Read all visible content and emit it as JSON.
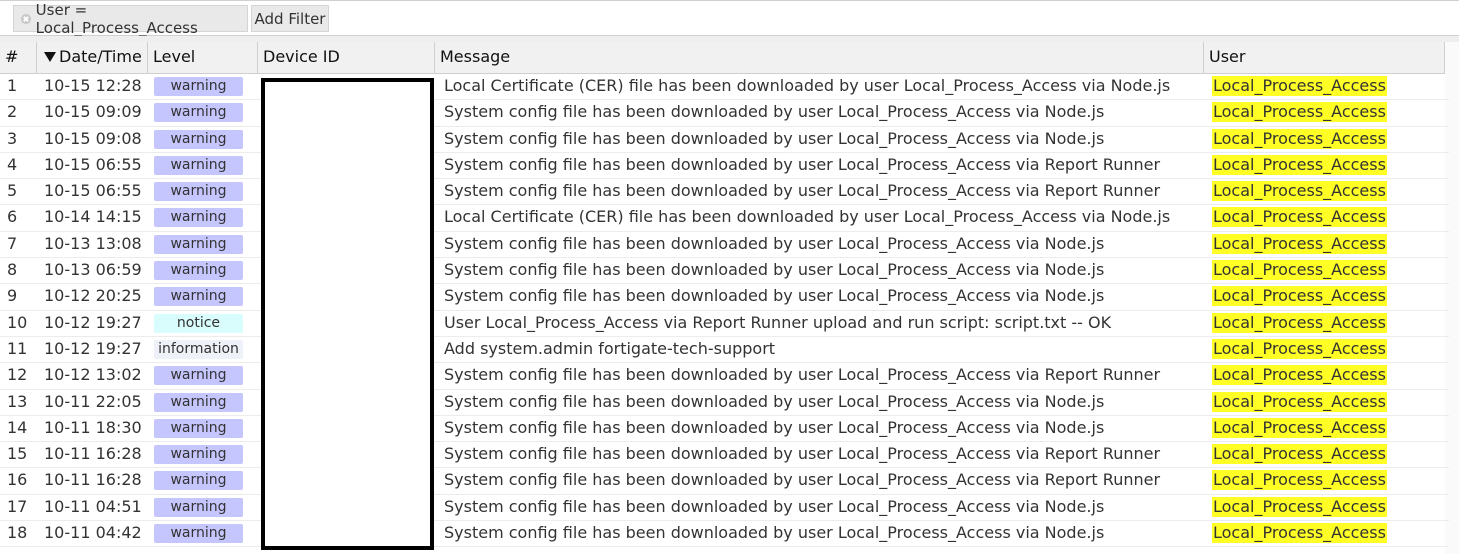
{
  "filter": {
    "chip_text": "User = Local_Process_Access",
    "add_filter_label": "Add Filter"
  },
  "columns": {
    "num": "#",
    "datetime": "Date/Time",
    "level": "Level",
    "device_id": "Device ID",
    "message": "Message",
    "user": "User"
  },
  "sort": {
    "column": "datetime",
    "direction": "descending",
    "icon": "sort-desc-icon"
  },
  "colors": {
    "warning": "#c6c6ff",
    "notice": "#d9fdfd",
    "information": "#eef2f8",
    "user_highlight": "#ffff26"
  },
  "rows": [
    {
      "num": "1",
      "datetime": "10-15 12:28",
      "level": "warning",
      "message": "Local Certificate (CER) file has been downloaded by user Local_Process_Access via Node.js",
      "user": "Local_Process_Access"
    },
    {
      "num": "2",
      "datetime": "10-15 09:09",
      "level": "warning",
      "message": "System config file has been downloaded by user Local_Process_Access via Node.js",
      "user": "Local_Process_Access"
    },
    {
      "num": "3",
      "datetime": "10-15 09:08",
      "level": "warning",
      "message": "System config file has been downloaded by user Local_Process_Access via Node.js",
      "user": "Local_Process_Access"
    },
    {
      "num": "4",
      "datetime": "10-15 06:55",
      "level": "warning",
      "message": "System config file has been downloaded by user Local_Process_Access via Report Runner",
      "user": "Local_Process_Access"
    },
    {
      "num": "5",
      "datetime": "10-15 06:55",
      "level": "warning",
      "message": "System config file has been downloaded by user Local_Process_Access via Report Runner",
      "user": "Local_Process_Access"
    },
    {
      "num": "6",
      "datetime": "10-14 14:15",
      "level": "warning",
      "message": "Local Certificate (CER) file has been downloaded by user Local_Process_Access via Node.js",
      "user": "Local_Process_Access"
    },
    {
      "num": "7",
      "datetime": "10-13 13:08",
      "level": "warning",
      "message": "System config file has been downloaded by user Local_Process_Access via Node.js",
      "user": "Local_Process_Access"
    },
    {
      "num": "8",
      "datetime": "10-13 06:59",
      "level": "warning",
      "message": "System config file has been downloaded by user Local_Process_Access via Node.js",
      "user": "Local_Process_Access"
    },
    {
      "num": "9",
      "datetime": "10-12 20:25",
      "level": "warning",
      "message": "System config file has been downloaded by user Local_Process_Access via Node.js",
      "user": "Local_Process_Access"
    },
    {
      "num": "10",
      "datetime": "10-12 19:27",
      "level": "notice",
      "message": "User Local_Process_Access  via Report Runner upload and run script: script.txt -- OK",
      "user": "Local_Process_Access"
    },
    {
      "num": "11",
      "datetime": "10-12 19:27",
      "level": "information",
      "message": "Add system.admin fortigate-tech-support",
      "user": "Local_Process_Access"
    },
    {
      "num": "12",
      "datetime": "10-12 13:02",
      "level": "warning",
      "message": "System config file has been downloaded by user Local_Process_Access via Report Runner",
      "user": "Local_Process_Access"
    },
    {
      "num": "13",
      "datetime": "10-11 22:05",
      "level": "warning",
      "message": "System config file has been downloaded by user Local_Process_Access via Node.js",
      "user": "Local_Process_Access"
    },
    {
      "num": "14",
      "datetime": "10-11 18:30",
      "level": "warning",
      "message": "System config file has been downloaded by user Local_Process_Access via Node.js",
      "user": "Local_Process_Access"
    },
    {
      "num": "15",
      "datetime": "10-11 16:28",
      "level": "warning",
      "message": "System config file has been downloaded by user Local_Process_Access via Report Runner",
      "user": "Local_Process_Access"
    },
    {
      "num": "16",
      "datetime": "10-11 16:28",
      "level": "warning",
      "message": "System config file has been downloaded by user Local_Process_Access via Report Runner",
      "user": "Local_Process_Access"
    },
    {
      "num": "17",
      "datetime": "10-11 04:51",
      "level": "warning",
      "message": "System config file has been downloaded by user Local_Process_Access via Node.js",
      "user": "Local_Process_Access"
    },
    {
      "num": "18",
      "datetime": "10-11 04:42",
      "level": "warning",
      "message": "System config file has been downloaded by user Local_Process_Access via Node.js",
      "user": "Local_Process_Access"
    }
  ]
}
